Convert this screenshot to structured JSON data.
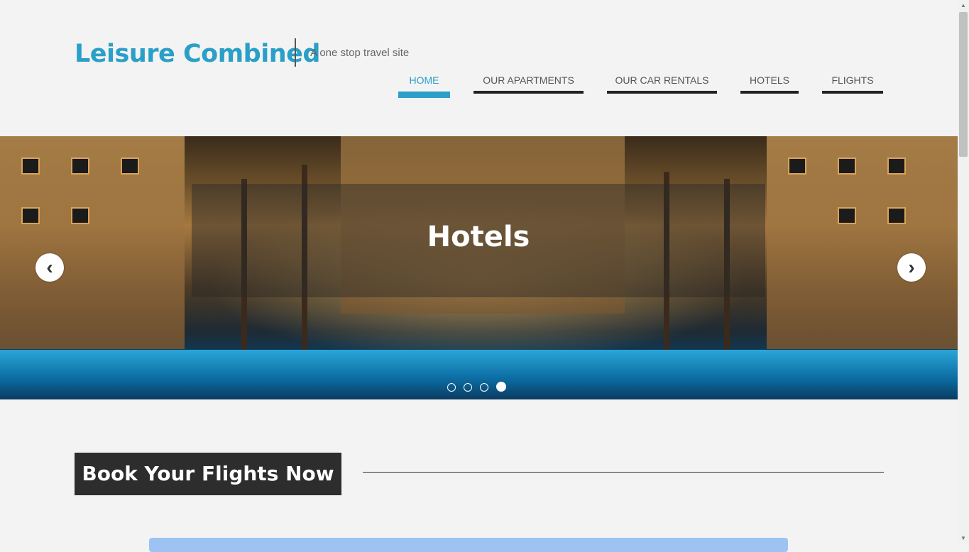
{
  "header": {
    "site_title": "Leisure Combined",
    "tagline": "A one stop travel site"
  },
  "nav": {
    "items": [
      {
        "label": "HOME",
        "active": true
      },
      {
        "label": "OUR APARTMENTS",
        "active": false
      },
      {
        "label": "OUR CAR RENTALS",
        "active": false
      },
      {
        "label": "HOTELS",
        "active": false
      },
      {
        "label": "FLIGHTS",
        "active": false
      }
    ]
  },
  "slider": {
    "caption": "Hotels",
    "prev_icon": "chevron-left-icon",
    "next_icon": "chevron-right-icon",
    "slides": 4,
    "current_slide": 4
  },
  "book": {
    "heading": "Book Your Flights Now"
  },
  "colors": {
    "accent": "#2a9fc8",
    "background": "#f3f3f3",
    "heading_bg": "#2d2d2d",
    "form_bar": "#9dc3f2"
  }
}
